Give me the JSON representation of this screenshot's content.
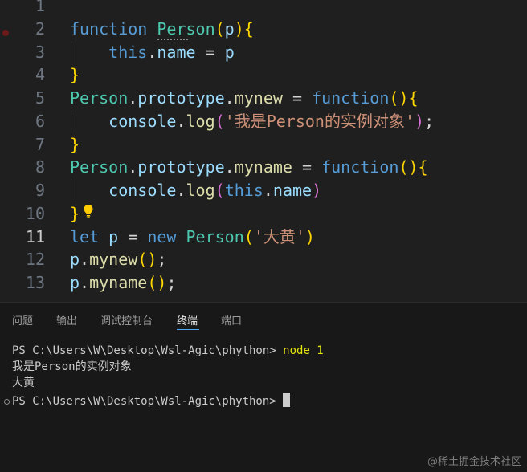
{
  "editor": {
    "lines": [
      {
        "num": "1",
        "tokens": []
      },
      {
        "num": "2",
        "tokens": [
          {
            "t": "function",
            "c": "kw"
          },
          {
            "t": " ",
            "c": "op"
          },
          {
            "t": "Person",
            "c": "cls"
          },
          {
            "t": "(",
            "c": "b1"
          },
          {
            "t": "p",
            "c": "var"
          },
          {
            "t": ")",
            "c": "b1"
          },
          {
            "t": "{",
            "c": "b1"
          }
        ]
      },
      {
        "num": "3",
        "tokens": [
          {
            "t": "    ",
            "c": "op"
          },
          {
            "t": "this",
            "c": "kw"
          },
          {
            "t": ".",
            "c": "op"
          },
          {
            "t": "name",
            "c": "var"
          },
          {
            "t": " = ",
            "c": "op"
          },
          {
            "t": "p",
            "c": "var"
          }
        ]
      },
      {
        "num": "4",
        "tokens": [
          {
            "t": "}",
            "c": "b1"
          }
        ]
      },
      {
        "num": "5",
        "tokens": [
          {
            "t": "Person",
            "c": "cls"
          },
          {
            "t": ".",
            "c": "op"
          },
          {
            "t": "prototype",
            "c": "var"
          },
          {
            "t": ".",
            "c": "op"
          },
          {
            "t": "mynew",
            "c": "fn"
          },
          {
            "t": " = ",
            "c": "op"
          },
          {
            "t": "function",
            "c": "kw"
          },
          {
            "t": "(",
            "c": "b1"
          },
          {
            "t": ")",
            "c": "b1"
          },
          {
            "t": "{",
            "c": "b1"
          }
        ]
      },
      {
        "num": "6",
        "tokens": [
          {
            "t": "    ",
            "c": "op"
          },
          {
            "t": "console",
            "c": "var"
          },
          {
            "t": ".",
            "c": "op"
          },
          {
            "t": "log",
            "c": "fn"
          },
          {
            "t": "(",
            "c": "b2"
          },
          {
            "t": "'我是Person的实例对象'",
            "c": "str"
          },
          {
            "t": ")",
            "c": "b2"
          },
          {
            "t": ";",
            "c": "op"
          }
        ]
      },
      {
        "num": "7",
        "tokens": [
          {
            "t": "}",
            "c": "b1"
          }
        ]
      },
      {
        "num": "8",
        "tokens": [
          {
            "t": "Person",
            "c": "cls"
          },
          {
            "t": ".",
            "c": "op"
          },
          {
            "t": "prototype",
            "c": "var"
          },
          {
            "t": ".",
            "c": "op"
          },
          {
            "t": "myname",
            "c": "fn"
          },
          {
            "t": " = ",
            "c": "op"
          },
          {
            "t": "function",
            "c": "kw"
          },
          {
            "t": "(",
            "c": "b1"
          },
          {
            "t": ")",
            "c": "b1"
          },
          {
            "t": "{",
            "c": "b1"
          }
        ]
      },
      {
        "num": "9",
        "tokens": [
          {
            "t": "    ",
            "c": "op"
          },
          {
            "t": "console",
            "c": "var"
          },
          {
            "t": ".",
            "c": "op"
          },
          {
            "t": "log",
            "c": "fn"
          },
          {
            "t": "(",
            "c": "b2"
          },
          {
            "t": "this",
            "c": "kw"
          },
          {
            "t": ".",
            "c": "op"
          },
          {
            "t": "name",
            "c": "var"
          },
          {
            "t": ")",
            "c": "b2"
          }
        ]
      },
      {
        "num": "10",
        "tokens": [
          {
            "t": "}",
            "c": "b1"
          }
        ]
      },
      {
        "num": "11",
        "tokens": [
          {
            "t": "let",
            "c": "kw"
          },
          {
            "t": " ",
            "c": "op"
          },
          {
            "t": "p",
            "c": "var"
          },
          {
            "t": " = ",
            "c": "op"
          },
          {
            "t": "new",
            "c": "kw"
          },
          {
            "t": " ",
            "c": "op"
          },
          {
            "t": "Person",
            "c": "cls"
          },
          {
            "t": "(",
            "c": "b1"
          },
          {
            "t": "'大黄'",
            "c": "str"
          },
          {
            "t": ")",
            "c": "b1"
          }
        ]
      },
      {
        "num": "12",
        "tokens": [
          {
            "t": "p",
            "c": "var"
          },
          {
            "t": ".",
            "c": "op"
          },
          {
            "t": "mynew",
            "c": "fn"
          },
          {
            "t": "(",
            "c": "b1"
          },
          {
            "t": ")",
            "c": "b1"
          },
          {
            "t": ";",
            "c": "op"
          }
        ]
      },
      {
        "num": "13",
        "tokens": [
          {
            "t": "p",
            "c": "var"
          },
          {
            "t": ".",
            "c": "op"
          },
          {
            "t": "myname",
            "c": "fn"
          },
          {
            "t": "(",
            "c": "b1"
          },
          {
            "t": ")",
            "c": "b1"
          },
          {
            "t": ";",
            "c": "op"
          }
        ]
      }
    ],
    "active_line": "11"
  },
  "panel": {
    "tabs": [
      "问题",
      "输出",
      "调试控制台",
      "终端",
      "端口"
    ],
    "active_tab": "终端",
    "terminal": {
      "line1_prompt": "PS C:\\Users\\W\\Desktop\\Wsl-Agic\\phython> ",
      "line1_cmd": "node 1",
      "line2": "我是Person的实例对象",
      "line3": "大黄",
      "line4_prompt": "PS C:\\Users\\W\\Desktop\\Wsl-Agic\\phython> "
    }
  },
  "watermark": "@稀土掘金技术社区",
  "colors": {
    "editor_bg": "#1f1f1f",
    "panel_bg": "#181818",
    "keyword": "#569cd6",
    "class": "#4ec9b0",
    "function": "#dcdcaa",
    "variable": "#9cdcfe",
    "string": "#ce9178",
    "bracket_gold": "#ffd700",
    "bracket_purple": "#da70d6",
    "tab_accent": "#4fa6f7",
    "terminal_cmd": "#e5e510"
  }
}
